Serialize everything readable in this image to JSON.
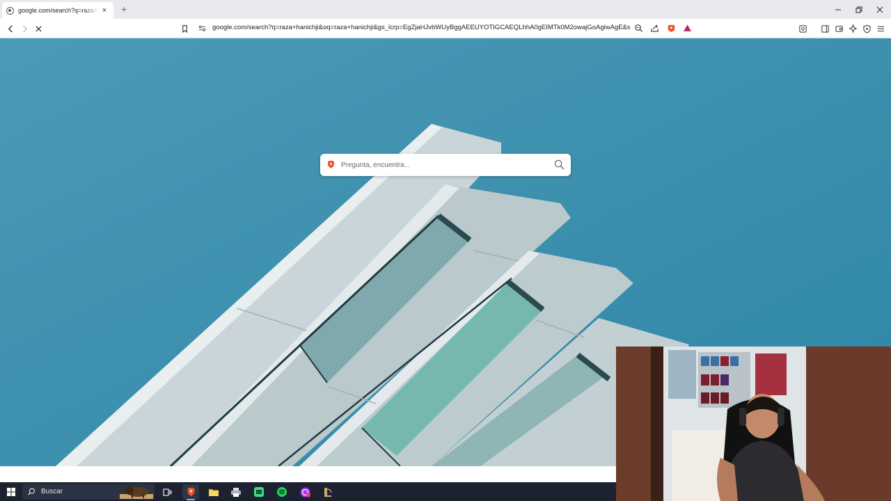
{
  "browser": {
    "tab_title": "google.com/search?q=raza+hanichji",
    "tab_close": "×",
    "new_tab": "+",
    "url": "google.com/search?q=raza+hanichji&oq=raza+hanichji&gs_lcrp=EgZjaHJvbWUyBggAEEUYOTIGCAEQLhhA0gEIMTk0M2owajGoAgiwAgE&sour..."
  },
  "page": {
    "search_placeholder": "Pregunta, encuentra..."
  },
  "taskbar": {
    "search_label": "Buscar"
  },
  "colors": {
    "sky": "#3a90ad",
    "tabstrip": "#e9eaed",
    "taskbar": "#1c2230",
    "brave_accent": "#e8542b"
  }
}
